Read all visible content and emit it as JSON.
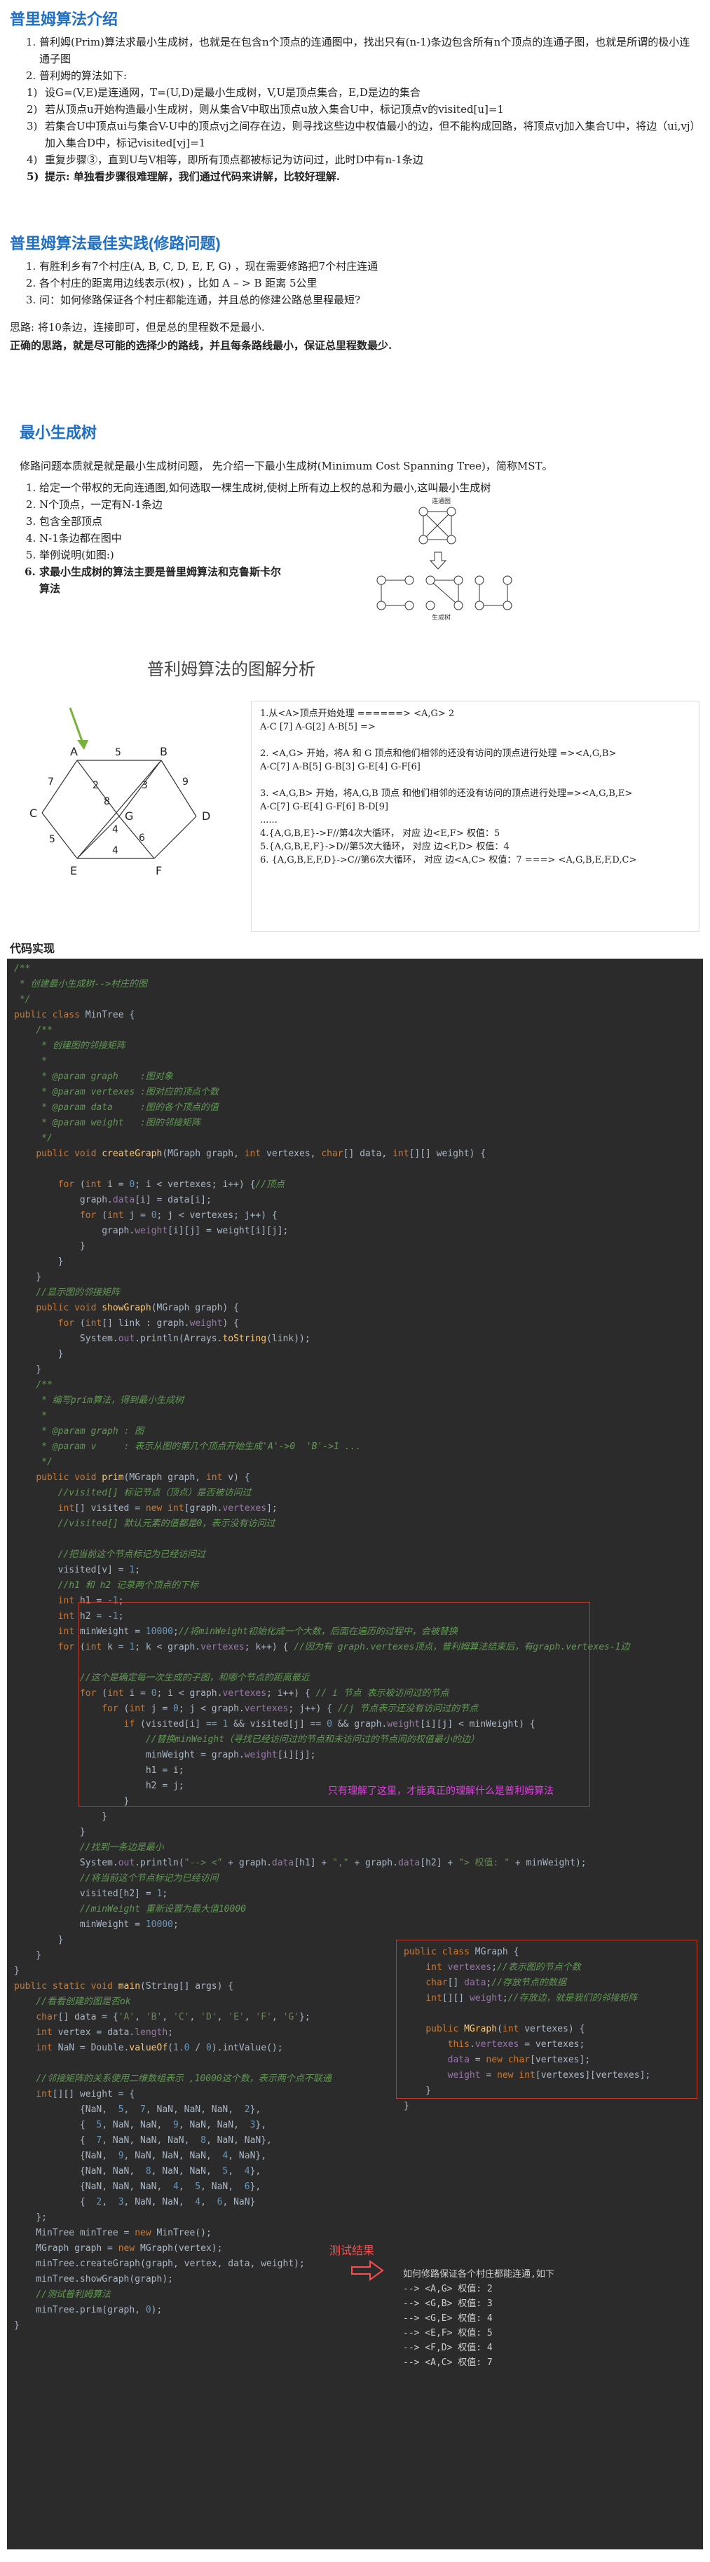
{
  "section1": {
    "title": "普里姆算法介绍",
    "items": [
      "普利姆(Prim)算法求最小生成树，也就是在包含n个顶点的连通图中，找出只有(n-1)条边包含所有n个顶点的连通子图，也就是所谓的极小连通子图",
      "普利姆的算法如下:"
    ],
    "steps": [
      "设G=(V,E)是连通网，T=(U,D)是最小生成树，V,U是顶点集合，E,D是边的集合",
      "若从顶点u开始构造最小生成树，则从集合V中取出顶点u放入集合U中，标记顶点v的visited[u]=1",
      "若集合U中顶点ui与集合V-U中的顶点vj之间存在边，则寻找这些边中权值最小的边，但不能构成回路，将顶点vj加入集合U中，将边（ui,vj）加入集合D中，标记visited[vj]=1",
      "重复步骤③，直到U与V相等，即所有顶点都被标记为访问过，此时D中有n-1条边",
      "提示: 单独看步骤很难理解，我们通过代码来讲解，比较好理解."
    ]
  },
  "section2": {
    "title": "普里姆算法最佳实践(修路问题)",
    "items": [
      "有胜利乡有7个村庄(A, B, C, D, E, F, G) ，现在需要修路把7个村庄连通",
      "各个村庄的距离用边线表示(权) ，比如 A – > B 距离 5公里",
      "问：如何修路保证各个村庄都能连通，并且总的修建公路总里程最短?"
    ],
    "note1": "思路: 将10条边，连接即可，但是总的里程数不是最小.",
    "note2": "正确的思路，就是尽可能的选择少的路线，并且每条路线最小，保证总里程数最少."
  },
  "section3": {
    "title": "最小生成树",
    "intro": "修路问题本质就是就是最小生成树问题， 先介绍一下最小生成树(Minimum Cost Spanning Tree)，简称MST。",
    "items": [
      "给定一个带权的无向连通图,如何选取一棵生成树,使树上所有边上权的总和为最小,这叫最小生成树",
      "N个顶点，一定有N-1条边",
      "包含全部顶点",
      "N-1条边都在图中",
      "举例说明(如图:)",
      "求最小生成树的算法主要是普里姆算法和克鲁斯卡尔算法"
    ],
    "fig_caption_top": "连通图",
    "fig_caption_bottom": "生成树"
  },
  "diagram_title": "普利姆算法的图解分析",
  "graph": {
    "vertices": [
      "A",
      "B",
      "C",
      "D",
      "E",
      "F",
      "G"
    ],
    "edge_weights": [
      "5",
      "7",
      "2",
      "3",
      "4",
      "9",
      "8",
      "5",
      "6",
      "4"
    ]
  },
  "steps_box": [
    "1.从<A>顶点开始处理 ======> <A,G> 2",
    "A-C [7] A-G[2] A-B[5] =>",
    "",
    "2. <A,G> 开始，将A 和 G 顶点和他们相邻的还没有访问的顶点进行处理 =><A,G,B>",
    "A-C[7] A-B[5]  G-B[3] G-E[4] G-F[6]",
    "",
    "3. <A,G,B> 开始，将A,G,B 顶点 和他们相邻的还没有访问的顶点进行处理=><A,G,B,E>",
    "A-C[7] G-E[4] G-F[6] B-D[9]",
    "......",
    "4.{A,G,B,E}->F//第4次大循环， 对应 边<E,F> 权值：5",
    "5.{A,G,B,E,F}->D//第5次大循环， 对应 边<F,D> 权值：4",
    "6. {A,G,B,E,F,D}->C//第6次大循环， 对应 边<A,C> 权值：7 ===> <A,G,B,E,F,D,C>"
  ],
  "code_title": "代码实现",
  "code_annotation": "只有理解了这里，才能真正的理解什么是普利姆算法",
  "test_label": "测试结果",
  "result": {
    "header": "如何修路保证各个村庄都能连通,如下",
    "rows": [
      "--> <A,G>  权值: 2",
      "--> <G,B>  权值: 3",
      "--> <G,E>  权值: 4",
      "--> <E,F>  权值: 5",
      "--> <F,D>  权值: 4",
      "--> <A,C>  权值: 7"
    ]
  },
  "colors": {
    "heading": "#1f6fc5",
    "code_bg": "#2b2b2b",
    "annotation": "#e040e0",
    "box": "#c0392b"
  }
}
